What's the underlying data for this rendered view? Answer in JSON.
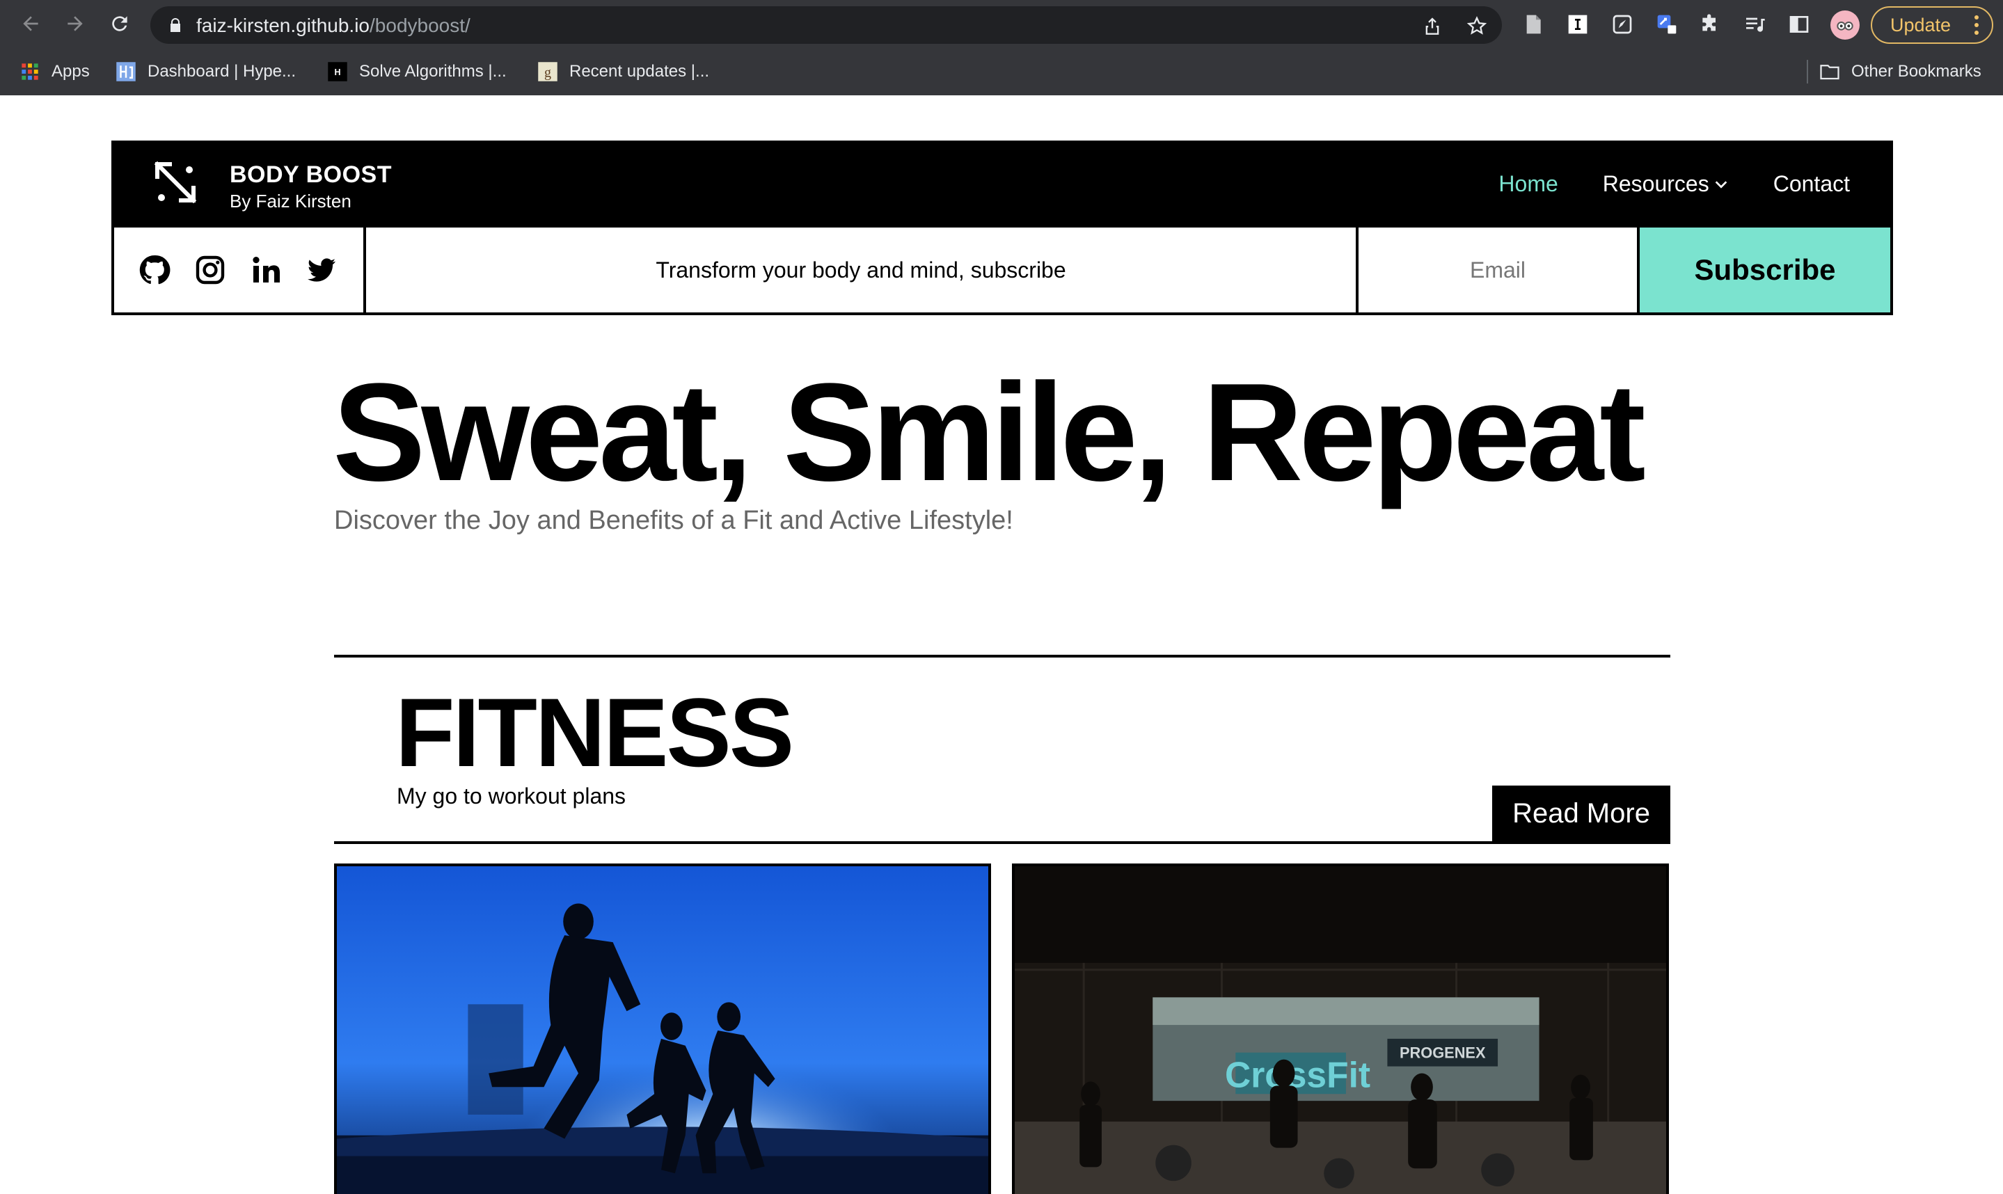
{
  "browser": {
    "url_host": "faiz-kirsten.github.io",
    "url_path": "/bodyboost/",
    "update_label": "Update",
    "bookmarks": [
      {
        "label": "Apps",
        "icon": "apps-grid-icon"
      },
      {
        "label": "Dashboard | Hype...",
        "icon": "hyperskill-icon"
      },
      {
        "label": "Solve Algorithms |...",
        "icon": "hackerrank-icon"
      },
      {
        "label": "Recent updates |...",
        "icon": "goodreads-icon"
      }
    ],
    "other_bookmarks": "Other Bookmarks"
  },
  "header": {
    "brand_name": "BODY BOOST",
    "brand_sub": "By Faiz Kirsten",
    "nav": [
      {
        "label": "Home",
        "active": true
      },
      {
        "label": "Resources",
        "dropdown": true
      },
      {
        "label": "Contact"
      }
    ],
    "accent": "#7be3cf"
  },
  "subscribe_bar": {
    "socials": [
      "github-icon",
      "instagram-icon",
      "linkedin-icon",
      "twitter-icon"
    ],
    "tagline": "Transform your body and mind, subscribe",
    "email_placeholder": "Email",
    "button_label": "Subscribe"
  },
  "hero": {
    "title": "Sweat, Smile, Repeat",
    "subtitle": "Discover the Joy and Benefits of a Fit and Active Lifestyle!"
  },
  "section": {
    "title": "FITNESS",
    "subtitle": "My go to workout plans",
    "read_more": "Read More"
  },
  "cards": [
    {
      "image": "runners-silhouette-photo"
    },
    {
      "image": "crossfit-gym-photo"
    }
  ]
}
